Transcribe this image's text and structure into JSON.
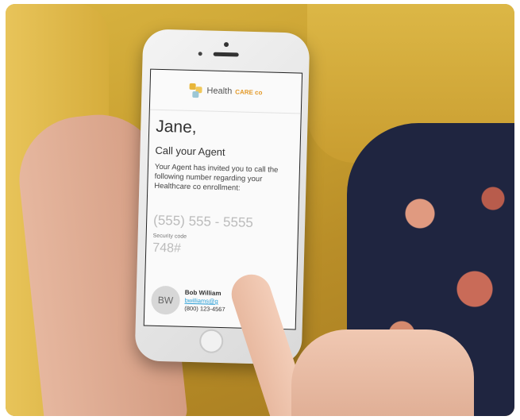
{
  "logo": {
    "text": "Health",
    "brand": "CARE co",
    "icon": "health-logo-icon"
  },
  "message": {
    "greeting": "Jane,",
    "subtitle": "Call your Agent",
    "body": "Your Agent has invited you to call the following number regarding your Healthcare co enrollment:",
    "phone": "(555) 555 - 5555",
    "security_label": "Security code",
    "security_code": "748#"
  },
  "agent": {
    "initials": "BW",
    "name": "Bob William",
    "email": "bwilliams@g",
    "phone": "(800) 123-4567"
  },
  "colors": {
    "accent": "#e39a2a",
    "link": "#2a9fd6",
    "sofa": "#c9a030"
  }
}
